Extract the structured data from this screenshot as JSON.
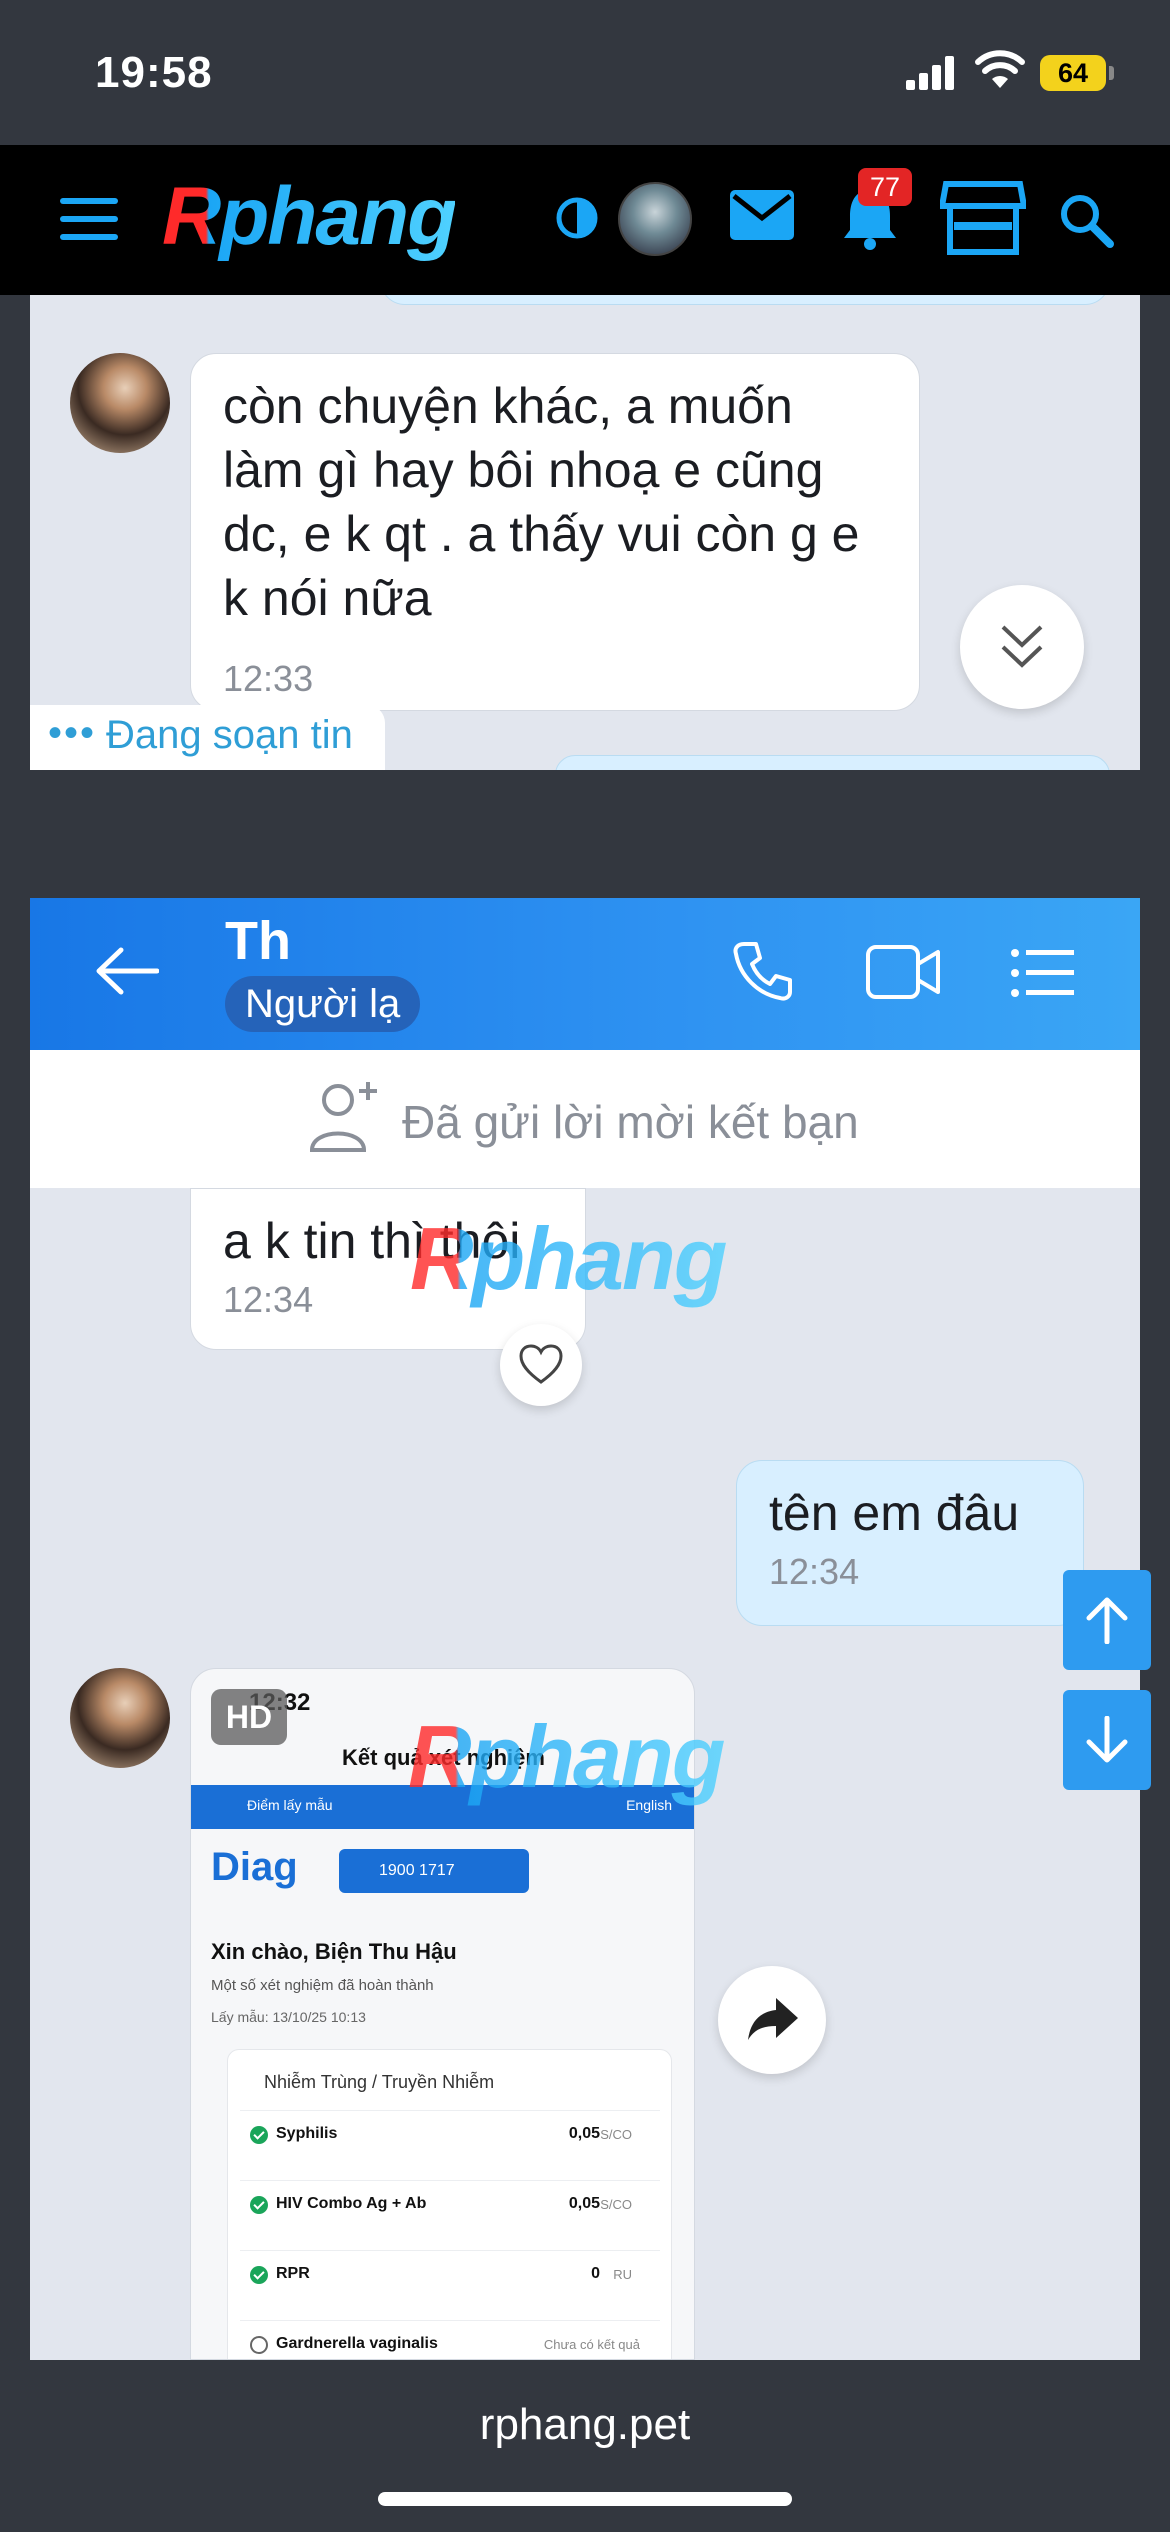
{
  "status_bar": {
    "time": "19:58",
    "battery": "64"
  },
  "site": {
    "logo": "Rphang",
    "notifications": "77",
    "url": "rphang.pet"
  },
  "chat_top": {
    "message": "còn chuyện khác, a muốn làm gì hay bôi nhoạ e cũng dc, e k qt . a thấy vui còn g e k nói nữa",
    "time": "12:33",
    "typing": "Đang soạn tin"
  },
  "chat_header": {
    "name": "Th",
    "status": "Người lạ"
  },
  "friend_request": {
    "text": "Đã gửi lời mời kết bạn"
  },
  "messages": [
    {
      "text": "a k tin thì thôi",
      "time": "12:34",
      "from": "them"
    },
    {
      "text": "tên em đâu",
      "time": "12:34",
      "from": "me"
    }
  ],
  "watermark": "Rphang",
  "embed": {
    "hd_badge": "HD",
    "status_time": "12:32",
    "title": "Kết quả xét nghiệm",
    "blue_left": "Điểm lấy mẫu",
    "blue_right": "English",
    "logo": "Diag",
    "phone": "1900 1717",
    "greeting": "Xin chào, Biện Thu Hậu",
    "sub": "Một số xét nghiệm đã hoàn thành",
    "sample": "Lấy mẫu: 13/10/25 10:13",
    "category": "Nhiễm Trùng / Truyền Nhiễm",
    "tests": [
      {
        "name": "Syphilis",
        "value": "0,05",
        "unit": "S/CO"
      },
      {
        "name": "HIV Combo Ag + Ab",
        "value": "0,05",
        "unit": "S/CO"
      },
      {
        "name": "RPR",
        "value": "0",
        "unit": "RU"
      },
      {
        "name": "Gardnerella vaginalis",
        "value": "Chưa có kết quả",
        "unit": ""
      }
    ]
  }
}
